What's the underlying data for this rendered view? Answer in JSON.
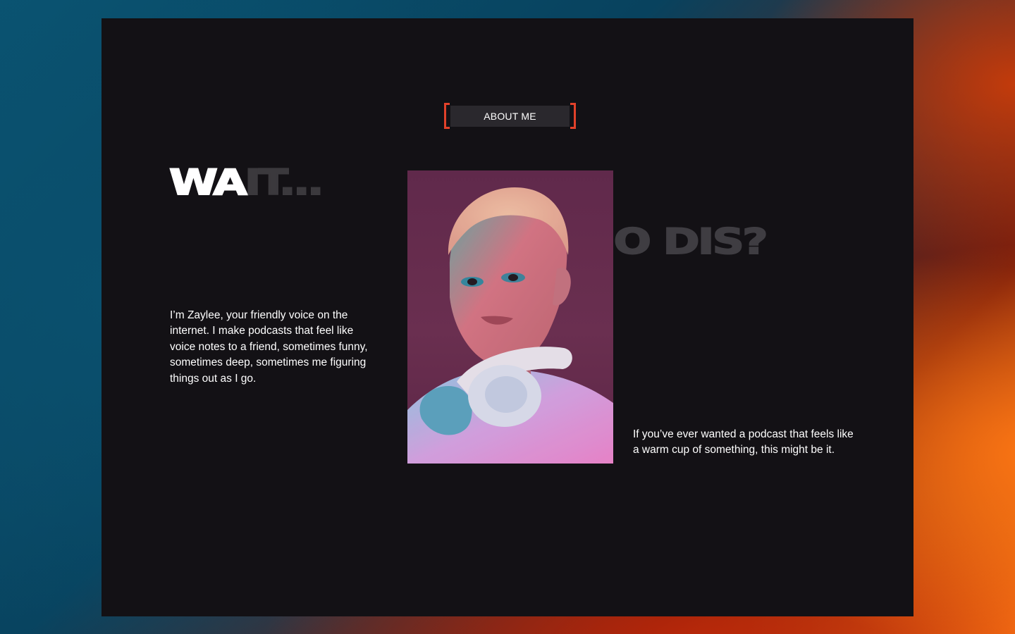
{
  "about": {
    "tag_label": "ABOUT ME",
    "accent_color": "#e2412a"
  },
  "headline": {
    "wait_bright": "WA",
    "wait_dim": "IT...",
    "who": "WHO DIS?"
  },
  "portrait": {
    "alt": "Portrait of Zaylee with headphones"
  },
  "intro": {
    "text": "I’m Zaylee, your friendly voice on the internet. I make podcasts that feel like voice notes to a friend, sometimes funny, sometimes deep, sometimes me figuring things out as I go."
  },
  "outro": {
    "text": "If you’ve ever wanted a podcast that feels like a warm cup of something, this might be it."
  }
}
